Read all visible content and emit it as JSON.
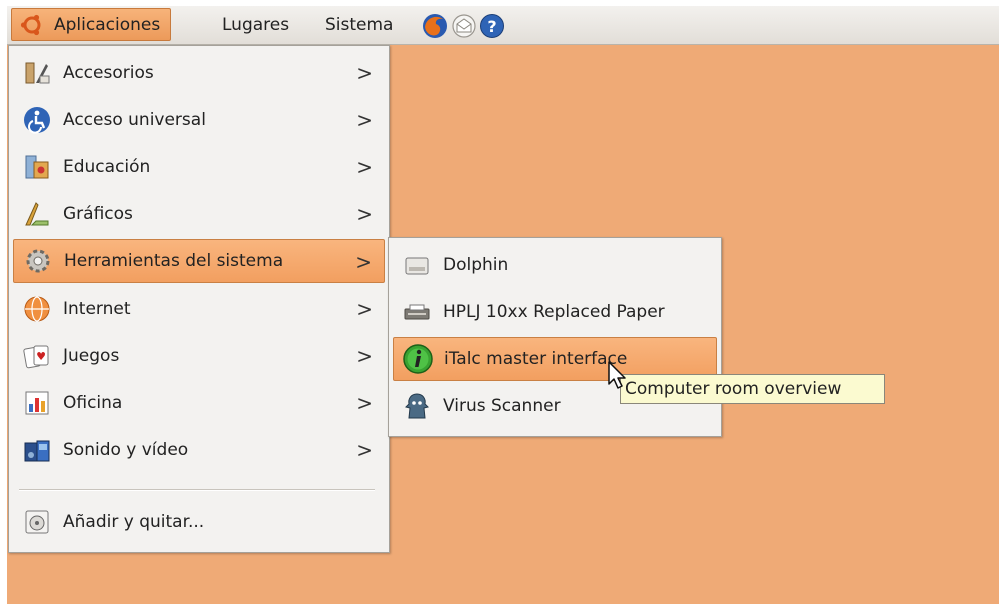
{
  "colors": {
    "desktop": "#efaa76",
    "highlight": "#f29f60",
    "tooltip": "#fbfad0"
  },
  "panel": {
    "applications": "Aplicaciones",
    "places": "Lugares",
    "system": "Sistema",
    "launchers": [
      "firefox-icon",
      "mail-icon",
      "help-icon"
    ]
  },
  "main_menu": {
    "items": [
      {
        "label": "Accesorios",
        "icon": "accessories-icon"
      },
      {
        "label": "Acceso universal",
        "icon": "accessibility-icon"
      },
      {
        "label": "Educación",
        "icon": "education-icon"
      },
      {
        "label": "Gráficos",
        "icon": "graphics-icon"
      },
      {
        "label": "Herramientas del sistema",
        "icon": "system-tools-icon"
      },
      {
        "label": "Internet",
        "icon": "internet-icon"
      },
      {
        "label": "Juegos",
        "icon": "games-icon"
      },
      {
        "label": "Oficina",
        "icon": "office-icon"
      },
      {
        "label": "Sonido y vídeo",
        "icon": "multimedia-icon"
      }
    ],
    "add_remove": "Añadir y quitar...",
    "submenu_arrow": ">"
  },
  "sub_menu": {
    "items": [
      {
        "label": "Dolphin",
        "icon": "drive-icon"
      },
      {
        "label": "HPLJ 10xx Replaced Paper",
        "icon": "printer-icon"
      },
      {
        "label": "iTalc master interface",
        "icon": "italc-icon"
      },
      {
        "label": "Virus Scanner",
        "icon": "virus-scanner-icon"
      }
    ]
  },
  "tooltip": "Computer room overview"
}
